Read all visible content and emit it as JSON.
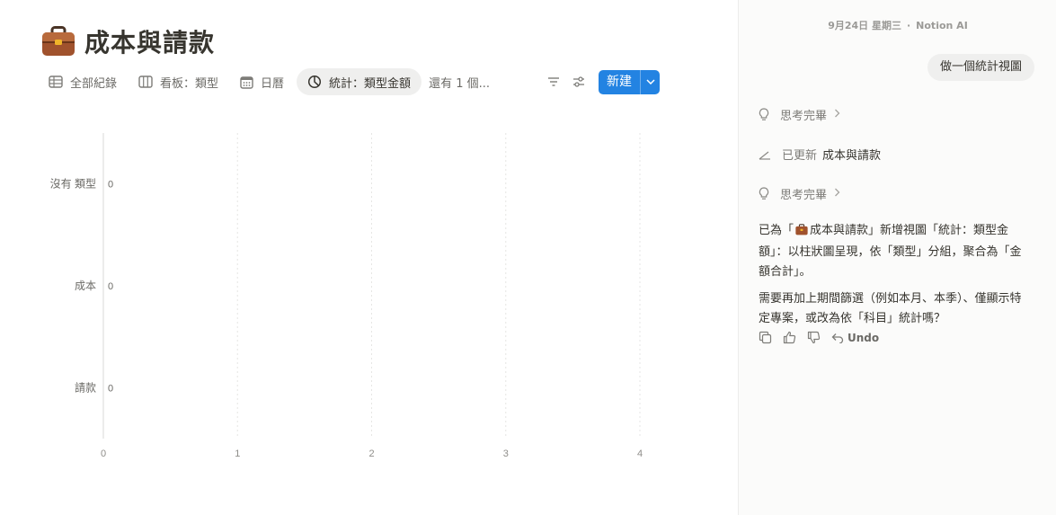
{
  "page": {
    "title": "成本與請款"
  },
  "toolbar": {
    "tabs": [
      {
        "label": "全部紀錄",
        "icon": "table-icon"
      },
      {
        "label": "看板：類型",
        "icon": "board-icon"
      },
      {
        "label": "日曆",
        "icon": "calendar-icon"
      },
      {
        "label": "統計：類型金額",
        "icon": "chart-icon",
        "active": true
      }
    ],
    "more_views": "還有 1 個...",
    "new_label": "新建"
  },
  "chart_data": {
    "type": "bar",
    "orientation": "horizontal",
    "categories": [
      "沒有 類型",
      "成本",
      "請款"
    ],
    "values": [
      0,
      0,
      0
    ],
    "data_labels": [
      "0",
      "0",
      "0"
    ],
    "xlim": [
      0,
      4
    ],
    "xticks": [
      "0",
      "1",
      "2",
      "3",
      "4"
    ],
    "grid": true,
    "title": "",
    "xlabel": "",
    "ylabel": ""
  },
  "side_panel": {
    "date": "9月24日 星期三",
    "separator": "·",
    "assistant": "Notion AI",
    "user_message": "做一個統計視圖",
    "steps": [
      {
        "label": "思考完畢",
        "icon": "lightbulb-icon"
      },
      {
        "label": "已更新",
        "target": "成本與請款",
        "icon": "edit-icon"
      },
      {
        "label": "思考完畢",
        "icon": "lightbulb-icon"
      }
    ],
    "answer": {
      "p1_before": "已為「",
      "p1_page": "成本與請款",
      "p1_after": "」新增視圖「統計：類型金額」：以柱狀圖呈現，依「類型」分組，聚合為「金額合計」。",
      "p2": "需要再加上期間篩選（例如本月、本季）、僅顯示特定專案，或改為依「科目」統計嗎？"
    },
    "actions": {
      "undo_label": "Undo"
    }
  },
  "colors": {
    "accent": "#2383e2",
    "briefcase": "#a0522d",
    "text": "#37352f",
    "muted": "#7d7c78"
  }
}
